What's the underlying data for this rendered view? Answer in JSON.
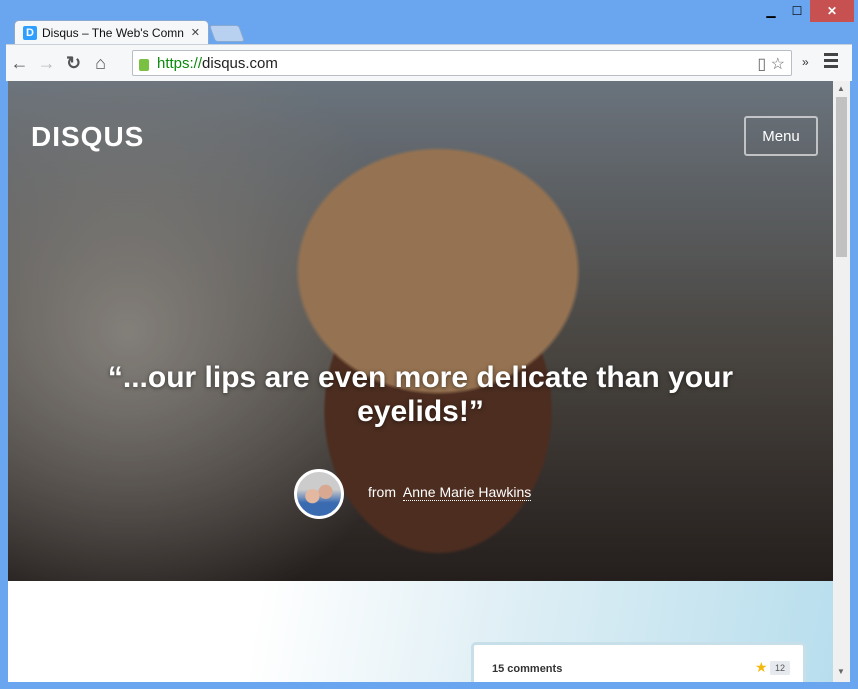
{
  "browser": {
    "tab_title": "Disqus – The Web's Comn",
    "url_scheme": "https://",
    "url_rest": "disqus.com"
  },
  "hero": {
    "logo": "DISQUS",
    "menu": "Menu",
    "quote": "“...our lips are even more delicate than your eyelids!”",
    "from": "from",
    "author": "Anne Marie Hawkins"
  },
  "card": {
    "comments": "15 comments",
    "star_count": "12"
  }
}
